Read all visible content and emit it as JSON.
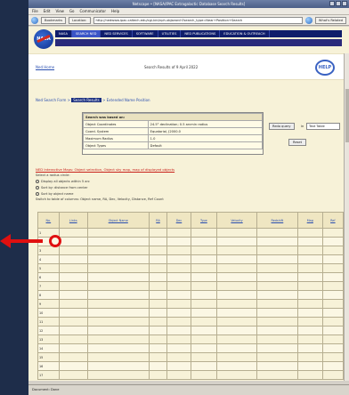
{
  "window": {
    "title": "Netscape • [NASA/IPAC Extragalactic Database Search Results]"
  },
  "menubar": [
    "File",
    "Edit",
    "View",
    "Go",
    "Communicator",
    "Help"
  ],
  "toolbar": {
    "back_label": "Bookmarks",
    "location_label": "Location:",
    "url": "http://nedwww.ipac.caltech.edu/cgi-bin/nph-objsearch?search_type=Near+Position+Search",
    "related_label": "What's Related"
  },
  "header": {
    "logo_text": "NASA",
    "nav": [
      "NASA",
      "SEARCH NED",
      "NED SERVICES",
      "SOFTWARE",
      "UTILITIES",
      "NED PUBLICATIONS",
      "EDUCATION & OUTREACH"
    ]
  },
  "strip": {
    "left_link": "Ned Home",
    "center_text": "Search Results of 9 April 2022",
    "help_label": "HELP"
  },
  "breadcrumb": {
    "items": [
      "Ned Search Form",
      "Search Results",
      "Extended Name Position"
    ],
    "current_index": 1
  },
  "query": {
    "header": "Search was based on:",
    "rows": [
      {
        "label": "Object Coordinates",
        "value": "24.5° declination; 0.5 arcmin radius"
      },
      {
        "label": "Coord. System",
        "value": "Equatorial, J2000.0"
      },
      {
        "label": "Maximum Radius",
        "value": "1.0"
      },
      {
        "label": "Object Types",
        "value": "Default"
      }
    ],
    "redo_label": "Redo query",
    "format_label": "in",
    "format_value": "Text Table",
    "reset_label": "Reset"
  },
  "notes": {
    "red_link": "NED Interactive Maps: Object selection, Object sky map, map of displayed objects",
    "line1": "Select a radius circle:",
    "options": [
      "Display all objects within 5 arc",
      "Sort by: distance from center",
      "Sort by object name",
      "Switch to table of columns: Object name, RA, Dec, Velocity, Distance, Ref Count"
    ]
  },
  "results": {
    "columns": [
      "No.",
      "Links",
      "Object Name",
      "RA",
      "Dec",
      "Type",
      "Velocity",
      "Redshift",
      "Mag",
      "Ref"
    ],
    "rows": [
      [
        "1",
        "",
        "",
        "",
        "",
        "",
        "",
        "",
        "",
        ""
      ],
      [
        "2",
        "",
        "",
        "",
        "",
        "",
        "",
        "",
        "",
        ""
      ],
      [
        "3",
        "",
        "",
        "",
        "",
        "",
        "",
        "",
        "",
        ""
      ],
      [
        "4",
        "",
        "",
        "",
        "",
        "",
        "",
        "",
        "",
        ""
      ],
      [
        "5",
        "",
        "",
        "",
        "",
        "",
        "",
        "",
        "",
        ""
      ],
      [
        "6",
        "",
        "",
        "",
        "",
        "",
        "",
        "",
        "",
        ""
      ],
      [
        "7",
        "",
        "",
        "",
        "",
        "",
        "",
        "",
        "",
        ""
      ],
      [
        "8",
        "",
        "",
        "",
        "",
        "",
        "",
        "",
        "",
        ""
      ],
      [
        "9",
        "",
        "",
        "",
        "",
        "",
        "",
        "",
        "",
        ""
      ],
      [
        "10",
        "",
        "",
        "",
        "",
        "",
        "",
        "",
        "",
        ""
      ],
      [
        "11",
        "",
        "",
        "",
        "",
        "",
        "",
        "",
        "",
        ""
      ],
      [
        "12",
        "",
        "",
        "",
        "",
        "",
        "",
        "",
        "",
        ""
      ],
      [
        "13",
        "",
        "",
        "",
        "",
        "",
        "",
        "",
        "",
        ""
      ],
      [
        "14",
        "",
        "",
        "",
        "",
        "",
        "",
        "",
        "",
        ""
      ],
      [
        "15",
        "",
        "",
        "",
        "",
        "",
        "",
        "",
        "",
        ""
      ],
      [
        "16",
        "",
        "",
        "",
        "",
        "",
        "",
        "",
        "",
        ""
      ],
      [
        "17",
        "",
        "",
        "",
        "",
        "",
        "",
        "",
        "",
        ""
      ]
    ]
  },
  "statusbar": {
    "text": "Document: Done"
  },
  "annotation": {
    "color": "#e01010"
  }
}
